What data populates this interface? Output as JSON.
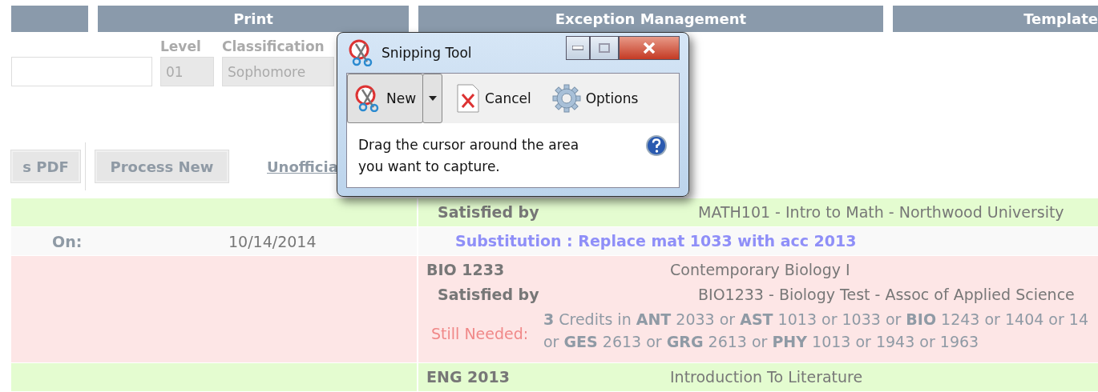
{
  "tabs": [
    {
      "label": "Print"
    },
    {
      "label": "Exception Management"
    },
    {
      "label": "Template"
    }
  ],
  "student_fields": [
    {
      "label": "Level",
      "value": "01",
      "disabled": true
    },
    {
      "label": "Classification",
      "value": "Sophomore",
      "disabled": true
    }
  ],
  "actions": {
    "buttons": [
      "s PDF",
      "Process New"
    ],
    "link": "Unofficia"
  },
  "rows": [
    {
      "color": "#e4fcd0",
      "lines": [
        {
          "kind": "satisfied",
          "label": "Satisfied by",
          "value": "MATH101 - Intro to Math - Northwood University"
        }
      ]
    },
    {
      "color": "#f9f9f9",
      "left_label": "On:",
      "left_value": "10/14/2014",
      "lines": [
        {
          "kind": "substitution",
          "text": "Substitution :  Replace mat 1033 with acc 2013"
        }
      ]
    },
    {
      "color": "#fde6e6",
      "lines": [
        {
          "kind": "course",
          "code": "BIO 1233",
          "title": "Contemporary Biology I"
        },
        {
          "kind": "satisfied",
          "label": "Satisfied by",
          "value": "BIO1233 - Biology Test - Assoc of Applied Science"
        },
        {
          "kind": "needed",
          "label": "Still Needed:",
          "text_lines": [
            "**3** Credits in **ANT** 2033 or **AST** 1013 or 1033 or **BIO** 1243 or 1404 or 14",
            "or **GES** 2613 or **GRG** 2613 or **PHY** 1013 or 1943 or 1963"
          ]
        }
      ]
    },
    {
      "color": "#e4fcd0",
      "lines": [
        {
          "kind": "course",
          "code": "ENG 2013",
          "title": "Introduction To Literature"
        }
      ]
    }
  ],
  "snipping_tool": {
    "title": "Snipping Tool",
    "tools": [
      {
        "kind": "new",
        "label": "New",
        "pressed": true
      },
      {
        "kind": "cancel",
        "label": "Cancel",
        "pressed": false
      },
      {
        "kind": "options",
        "label": "Options",
        "pressed": false
      }
    ],
    "hint": "Drag the cursor around the area you want to capture."
  }
}
